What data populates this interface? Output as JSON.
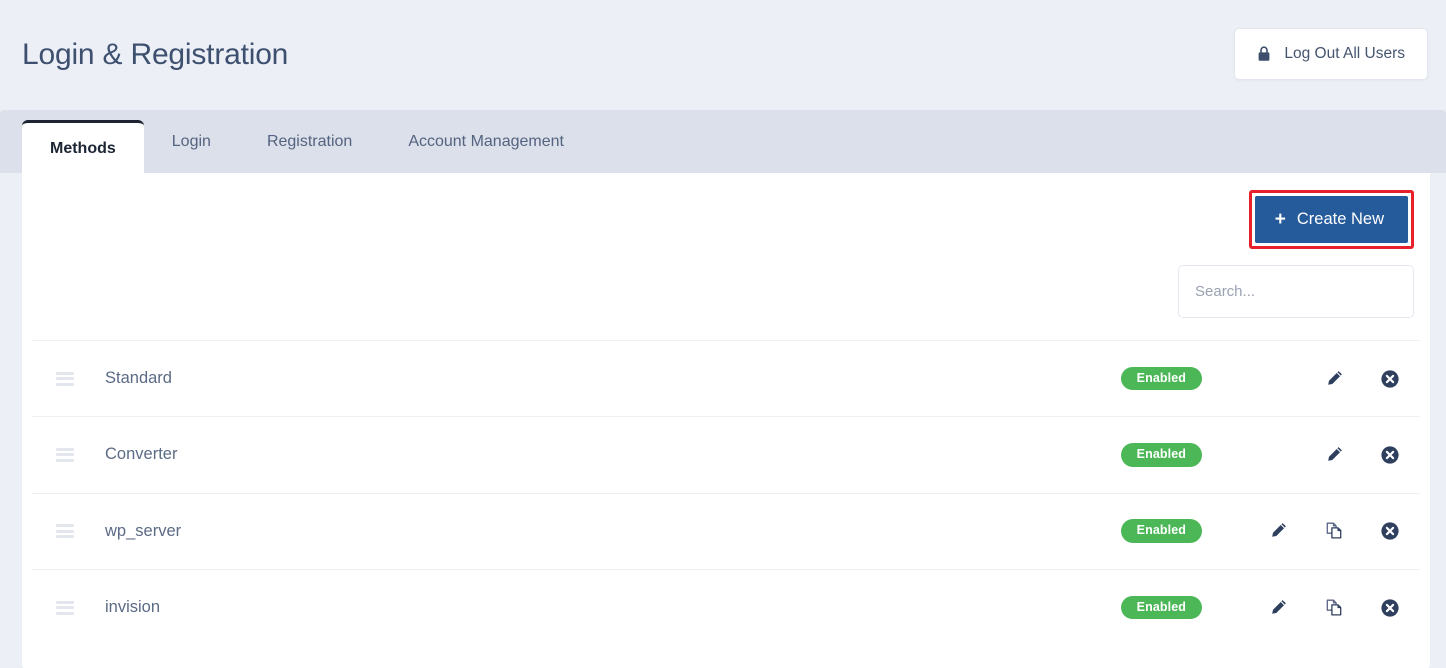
{
  "header": {
    "title": "Login & Registration",
    "logout_button": {
      "label": "Log Out All Users",
      "icon": "lock-icon"
    }
  },
  "tabs": [
    {
      "label": "Methods",
      "active": true
    },
    {
      "label": "Login",
      "active": false
    },
    {
      "label": "Registration",
      "active": false
    },
    {
      "label": "Account Management",
      "active": false
    }
  ],
  "toolbar": {
    "create_new_label": "Create New",
    "create_new_icon": "plus-icon",
    "create_new_highlighted": true
  },
  "search": {
    "value": "",
    "placeholder": "Search..."
  },
  "methods_table": {
    "rows": [
      {
        "name": "Standard",
        "status": "Enabled",
        "drag_handle_icon": "drag-handle-icon",
        "actions": [
          "edit-icon",
          "delete-icon"
        ]
      },
      {
        "name": "Converter",
        "status": "Enabled",
        "drag_handle_icon": "drag-handle-icon",
        "actions": [
          "edit-icon",
          "delete-icon"
        ]
      },
      {
        "name": "wp_server",
        "status": "Enabled",
        "drag_handle_icon": "drag-handle-icon",
        "actions": [
          "edit-icon",
          "copy-icon",
          "delete-icon"
        ]
      },
      {
        "name": "invision",
        "status": "Enabled",
        "drag_handle_icon": "drag-handle-icon",
        "actions": [
          "edit-icon",
          "copy-icon",
          "delete-icon"
        ]
      }
    ]
  },
  "colors": {
    "page_background": "#eceff5",
    "title_text": "#3e5070",
    "tab_strip": "#dbe0ea",
    "active_tab_border": "#1d2430",
    "primary_button": "#255a9b",
    "highlight_outline": "#e8202a",
    "status_enabled": "#4cb757",
    "icon_navy": "#2f3f5e"
  }
}
